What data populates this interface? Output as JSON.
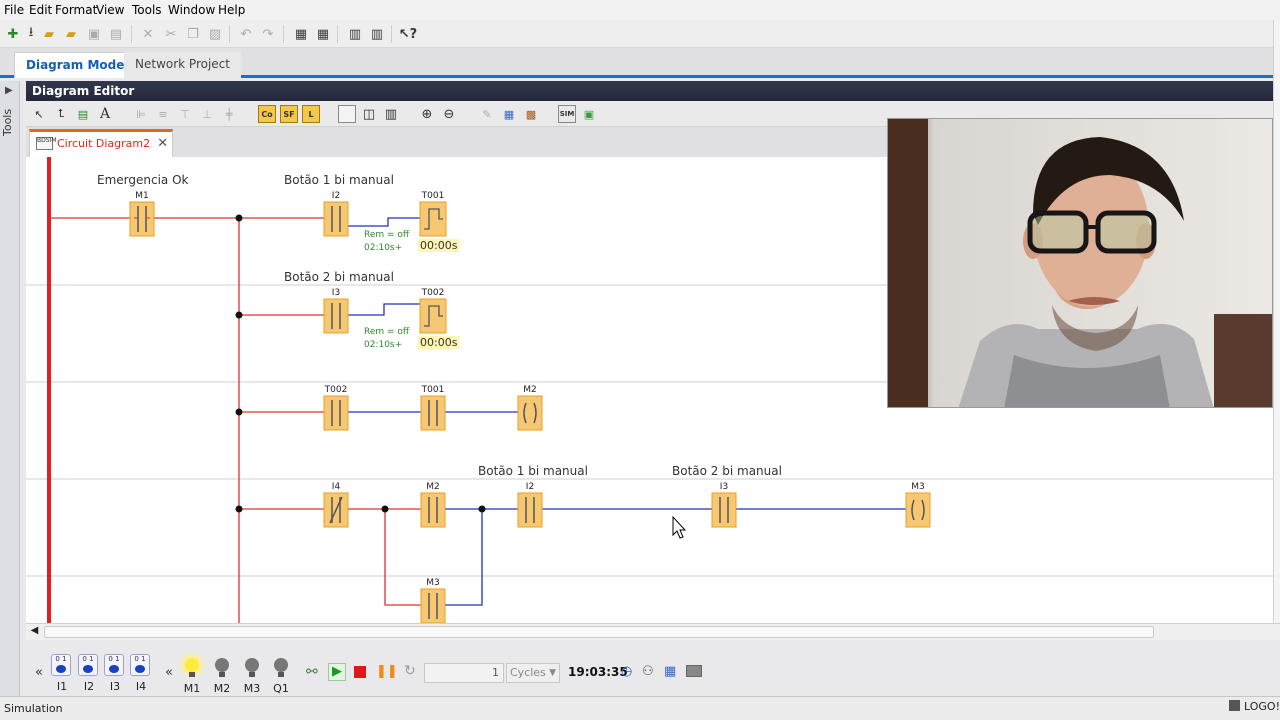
{
  "menu": [
    "File",
    "Edit",
    "Format",
    "View",
    "Tools",
    "Window",
    "Help"
  ],
  "mode_tabs": {
    "active": "Diagram Mode",
    "inactive": "Network Project"
  },
  "side_panel": {
    "label": "Tools"
  },
  "editor": {
    "title": "Diagram Editor",
    "doc_tab": "Circuit Diagram2",
    "doc_tab_icon": "BDSIM"
  },
  "toolbar2_boxes": {
    "co": "Co",
    "sf": "SF",
    "l": "L"
  },
  "diagram": {
    "row_labels": {
      "r1_left": "Emergencia Ok",
      "r1_right": "Botão 1 bi manual",
      "r2": "Botão 2 bi manual",
      "r4a": "Botão 1 bi manual",
      "r4b": "Botão 2 bi manual"
    },
    "blocks": {
      "b_m1": "M1",
      "b_i2a": "I2",
      "b_t001a": "T001",
      "b_i3a": "I3",
      "b_t002a": "T002",
      "b_t002b": "T002",
      "b_t001b": "T001",
      "b_m2a": "M2",
      "b_i4": "I4",
      "b_m2b": "M2",
      "b_i2b": "I2",
      "b_i3b": "I3",
      "b_m3a": "M3",
      "b_m3b": "M3"
    },
    "timers": [
      {
        "rem": "Rem = off",
        "param": "02:10s+",
        "value": "00:00s"
      },
      {
        "rem": "Rem = off",
        "param": "02:10s+",
        "value": "00:00s"
      }
    ]
  },
  "simulation": {
    "inputs": [
      "I1",
      "I2",
      "I3",
      "I4"
    ],
    "input_bits": "0 1",
    "outputs": [
      {
        "name": "M1",
        "on": true
      },
      {
        "name": "M2",
        "on": false
      },
      {
        "name": "M3",
        "on": false
      },
      {
        "name": "Q1",
        "on": false
      }
    ],
    "cycles_value": "1",
    "cycles_unit": "Cycles",
    "time": "19:03:35"
  },
  "status": {
    "text": "Simulation",
    "product": "LOGO!"
  },
  "colors": {
    "power_rail": "#e02020",
    "active_wire": "#e03030",
    "inactive_wire": "#2030c0",
    "block_fill": "#f7c873",
    "block_border": "#e8a020",
    "accent": "#1c6fc4"
  }
}
